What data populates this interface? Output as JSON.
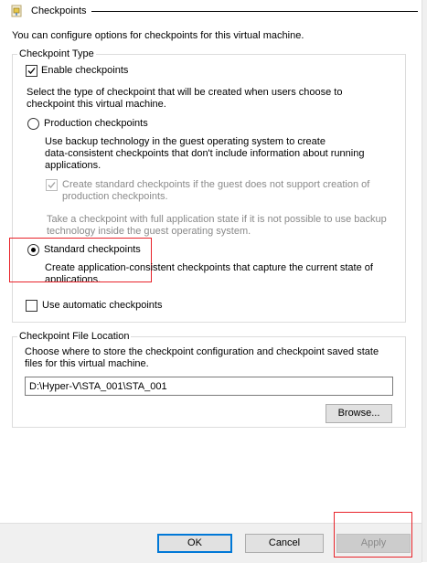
{
  "header": {
    "title": "Checkpoints",
    "icon": "checkpoint-page-icon"
  },
  "intro_text": "You can configure options for checkpoints for this virtual machine.",
  "checkpoint_type": {
    "legend": "Checkpoint Type",
    "enable_checkpoints": {
      "label": "Enable checkpoints",
      "checked": true
    },
    "select_text_lines": [
      "Select the type of checkpoint that will be created when users choose to",
      "checkpoint this virtual machine."
    ],
    "production": {
      "label": "Production checkpoints",
      "selected": false,
      "description_lines": [
        "Use backup technology in the guest operating system to create",
        "data-consistent checkpoints that don't include information about running",
        "applications."
      ],
      "fallback": {
        "label_lines": [
          "Create standard checkpoints if the guest does not support creation of",
          "production checkpoints."
        ],
        "checked": true,
        "enabled": false
      }
    },
    "full_state_note_lines": [
      "Take a checkpoint with full application state if it is not possible to use backup",
      "technology inside the guest operating system."
    ],
    "standard": {
      "label": "Standard checkpoints",
      "selected": true,
      "description_lines": [
        "Create application-consistent checkpoints that capture the current state of",
        "applications."
      ]
    },
    "automatic": {
      "label": "Use automatic checkpoints",
      "checked": false
    }
  },
  "file_location": {
    "legend": "Checkpoint File Location",
    "description_lines": [
      "Choose where to store the checkpoint configuration and checkpoint saved state",
      "files for this virtual machine."
    ],
    "path_value": "D:\\Hyper-V\\STA_001\\STA_001",
    "browse_label": "Browse..."
  },
  "footer": {
    "ok_label": "OK",
    "cancel_label": "Cancel",
    "apply_label": "Apply"
  },
  "colors": {
    "highlight": "#e8232a",
    "accent": "#0078d7"
  }
}
